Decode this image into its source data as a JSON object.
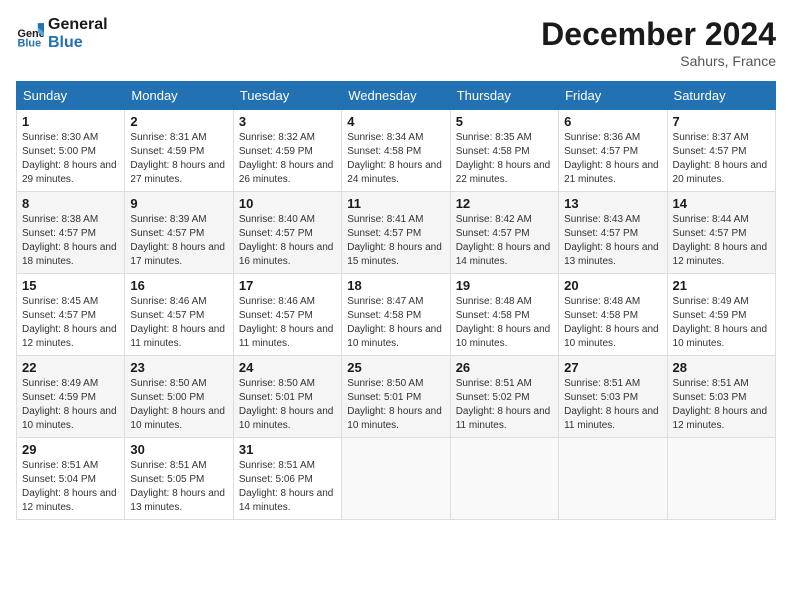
{
  "header": {
    "logo_line1": "General",
    "logo_line2": "Blue",
    "month_title": "December 2024",
    "subtitle": "Sahurs, France"
  },
  "weekdays": [
    "Sunday",
    "Monday",
    "Tuesday",
    "Wednesday",
    "Thursday",
    "Friday",
    "Saturday"
  ],
  "weeks": [
    [
      {
        "day": "1",
        "sunrise": "Sunrise: 8:30 AM",
        "sunset": "Sunset: 5:00 PM",
        "daylight": "Daylight: 8 hours and 29 minutes."
      },
      {
        "day": "2",
        "sunrise": "Sunrise: 8:31 AM",
        "sunset": "Sunset: 4:59 PM",
        "daylight": "Daylight: 8 hours and 27 minutes."
      },
      {
        "day": "3",
        "sunrise": "Sunrise: 8:32 AM",
        "sunset": "Sunset: 4:59 PM",
        "daylight": "Daylight: 8 hours and 26 minutes."
      },
      {
        "day": "4",
        "sunrise": "Sunrise: 8:34 AM",
        "sunset": "Sunset: 4:58 PM",
        "daylight": "Daylight: 8 hours and 24 minutes."
      },
      {
        "day": "5",
        "sunrise": "Sunrise: 8:35 AM",
        "sunset": "Sunset: 4:58 PM",
        "daylight": "Daylight: 8 hours and 22 minutes."
      },
      {
        "day": "6",
        "sunrise": "Sunrise: 8:36 AM",
        "sunset": "Sunset: 4:57 PM",
        "daylight": "Daylight: 8 hours and 21 minutes."
      },
      {
        "day": "7",
        "sunrise": "Sunrise: 8:37 AM",
        "sunset": "Sunset: 4:57 PM",
        "daylight": "Daylight: 8 hours and 20 minutes."
      }
    ],
    [
      {
        "day": "8",
        "sunrise": "Sunrise: 8:38 AM",
        "sunset": "Sunset: 4:57 PM",
        "daylight": "Daylight: 8 hours and 18 minutes."
      },
      {
        "day": "9",
        "sunrise": "Sunrise: 8:39 AM",
        "sunset": "Sunset: 4:57 PM",
        "daylight": "Daylight: 8 hours and 17 minutes."
      },
      {
        "day": "10",
        "sunrise": "Sunrise: 8:40 AM",
        "sunset": "Sunset: 4:57 PM",
        "daylight": "Daylight: 8 hours and 16 minutes."
      },
      {
        "day": "11",
        "sunrise": "Sunrise: 8:41 AM",
        "sunset": "Sunset: 4:57 PM",
        "daylight": "Daylight: 8 hours and 15 minutes."
      },
      {
        "day": "12",
        "sunrise": "Sunrise: 8:42 AM",
        "sunset": "Sunset: 4:57 PM",
        "daylight": "Daylight: 8 hours and 14 minutes."
      },
      {
        "day": "13",
        "sunrise": "Sunrise: 8:43 AM",
        "sunset": "Sunset: 4:57 PM",
        "daylight": "Daylight: 8 hours and 13 minutes."
      },
      {
        "day": "14",
        "sunrise": "Sunrise: 8:44 AM",
        "sunset": "Sunset: 4:57 PM",
        "daylight": "Daylight: 8 hours and 12 minutes."
      }
    ],
    [
      {
        "day": "15",
        "sunrise": "Sunrise: 8:45 AM",
        "sunset": "Sunset: 4:57 PM",
        "daylight": "Daylight: 8 hours and 12 minutes."
      },
      {
        "day": "16",
        "sunrise": "Sunrise: 8:46 AM",
        "sunset": "Sunset: 4:57 PM",
        "daylight": "Daylight: 8 hours and 11 minutes."
      },
      {
        "day": "17",
        "sunrise": "Sunrise: 8:46 AM",
        "sunset": "Sunset: 4:57 PM",
        "daylight": "Daylight: 8 hours and 11 minutes."
      },
      {
        "day": "18",
        "sunrise": "Sunrise: 8:47 AM",
        "sunset": "Sunset: 4:58 PM",
        "daylight": "Daylight: 8 hours and 10 minutes."
      },
      {
        "day": "19",
        "sunrise": "Sunrise: 8:48 AM",
        "sunset": "Sunset: 4:58 PM",
        "daylight": "Daylight: 8 hours and 10 minutes."
      },
      {
        "day": "20",
        "sunrise": "Sunrise: 8:48 AM",
        "sunset": "Sunset: 4:58 PM",
        "daylight": "Daylight: 8 hours and 10 minutes."
      },
      {
        "day": "21",
        "sunrise": "Sunrise: 8:49 AM",
        "sunset": "Sunset: 4:59 PM",
        "daylight": "Daylight: 8 hours and 10 minutes."
      }
    ],
    [
      {
        "day": "22",
        "sunrise": "Sunrise: 8:49 AM",
        "sunset": "Sunset: 4:59 PM",
        "daylight": "Daylight: 8 hours and 10 minutes."
      },
      {
        "day": "23",
        "sunrise": "Sunrise: 8:50 AM",
        "sunset": "Sunset: 5:00 PM",
        "daylight": "Daylight: 8 hours and 10 minutes."
      },
      {
        "day": "24",
        "sunrise": "Sunrise: 8:50 AM",
        "sunset": "Sunset: 5:01 PM",
        "daylight": "Daylight: 8 hours and 10 minutes."
      },
      {
        "day": "25",
        "sunrise": "Sunrise: 8:50 AM",
        "sunset": "Sunset: 5:01 PM",
        "daylight": "Daylight: 8 hours and 10 minutes."
      },
      {
        "day": "26",
        "sunrise": "Sunrise: 8:51 AM",
        "sunset": "Sunset: 5:02 PM",
        "daylight": "Daylight: 8 hours and 11 minutes."
      },
      {
        "day": "27",
        "sunrise": "Sunrise: 8:51 AM",
        "sunset": "Sunset: 5:03 PM",
        "daylight": "Daylight: 8 hours and 11 minutes."
      },
      {
        "day": "28",
        "sunrise": "Sunrise: 8:51 AM",
        "sunset": "Sunset: 5:03 PM",
        "daylight": "Daylight: 8 hours and 12 minutes."
      }
    ],
    [
      {
        "day": "29",
        "sunrise": "Sunrise: 8:51 AM",
        "sunset": "Sunset: 5:04 PM",
        "daylight": "Daylight: 8 hours and 12 minutes."
      },
      {
        "day": "30",
        "sunrise": "Sunrise: 8:51 AM",
        "sunset": "Sunset: 5:05 PM",
        "daylight": "Daylight: 8 hours and 13 minutes."
      },
      {
        "day": "31",
        "sunrise": "Sunrise: 8:51 AM",
        "sunset": "Sunset: 5:06 PM",
        "daylight": "Daylight: 8 hours and 14 minutes."
      },
      null,
      null,
      null,
      null
    ]
  ]
}
